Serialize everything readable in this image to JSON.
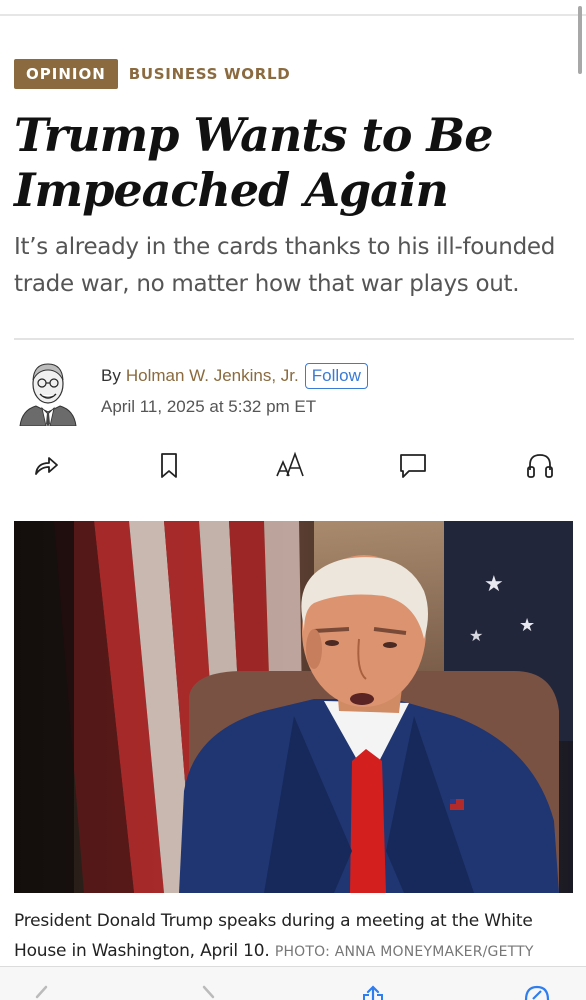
{
  "tags": {
    "opinion": "OPINION",
    "section": "BUSINESS WORLD"
  },
  "headline": "Trump Wants to Be Impeached Again",
  "dek": "It’s already in the cards thanks to his ill-founded trade war, no matter how that war plays out.",
  "byline": {
    "by": "By",
    "author": "Holman W. Jenkins, Jr.",
    "follow_label": "Follow",
    "date": "April 11, 2025 at 5:32 pm ET"
  },
  "toolbar": {
    "icons": [
      "share-icon",
      "bookmark-icon",
      "text-size-icon",
      "comment-icon",
      "headphones-icon"
    ],
    "text_size_label": "AA"
  },
  "photo": {
    "subject": "photo-president"
  },
  "caption": {
    "text": "President Donald Trump speaks during a meeting at the White House in Washington, April 10.",
    "credit": "PHOTO: ANNA MONEYMAKER/GETTY"
  },
  "colors": {
    "accent": "#8a6a3e",
    "follow": "#3a7bd5"
  }
}
